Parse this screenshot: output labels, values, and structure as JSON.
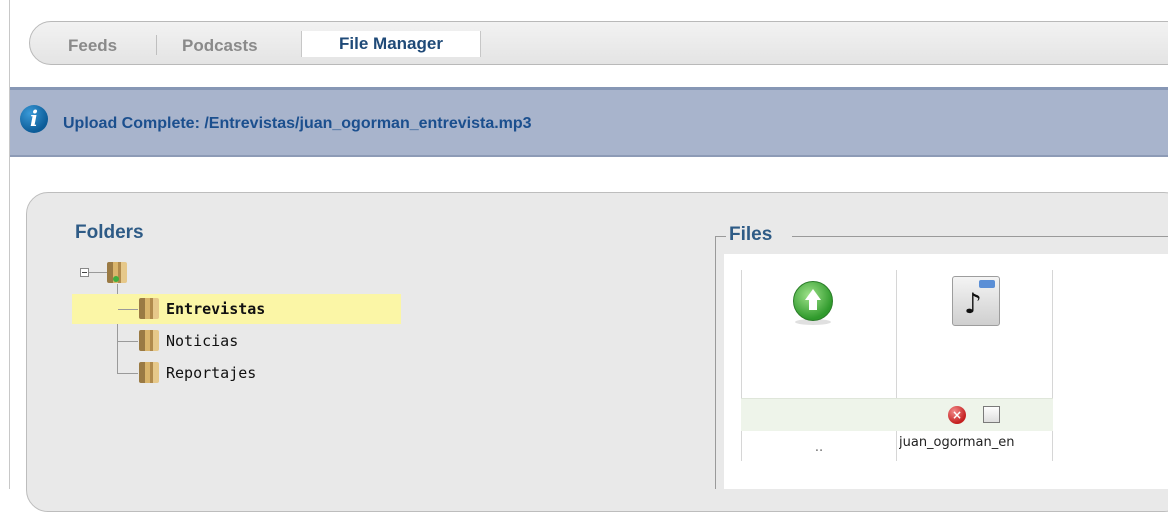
{
  "tabs": [
    {
      "label": "Feeds",
      "active": false
    },
    {
      "label": "Podcasts",
      "active": false
    },
    {
      "label": "File Manager",
      "active": true
    }
  ],
  "notification": {
    "icon": "info-icon",
    "message": "Upload Complete: /Entrevistas/juan_ogorman_entrevista.mp3"
  },
  "folders": {
    "title": "Folders",
    "root_icon": "folder-root-icon",
    "items": [
      {
        "label": "Entrevistas",
        "selected": true
      },
      {
        "label": "Noticias",
        "selected": false
      },
      {
        "label": "Reportajes",
        "selected": false
      }
    ]
  },
  "files": {
    "title": "Files",
    "items": [
      {
        "type": "parent",
        "icon": "up-arrow-icon",
        "name": ".."
      },
      {
        "type": "file",
        "icon": "mp3-file-icon",
        "name": "juan_ogorman_en"
      }
    ]
  },
  "colors": {
    "notice_bg": "#a8b4cc",
    "notice_text": "#1b4f8e",
    "heading": "#2e5b86",
    "selected_row": "#fbf6a6",
    "panel_bg": "#e9e9e9"
  }
}
